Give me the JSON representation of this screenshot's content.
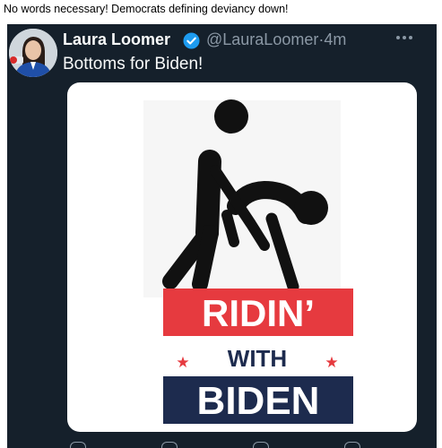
{
  "post": {
    "caption": "No words necessary! Democrats defining deviancy down!"
  },
  "tweet": {
    "author_name": "Laura Loomer",
    "handle": "@LauraLoomer",
    "separator": "·",
    "time": "4m",
    "text": "Bottoms for Biden!",
    "verified_icon": "verified-badge-icon",
    "more_icon": "more-options-icon"
  },
  "image": {
    "line1": "RIDIN’",
    "line2": "WITH",
    "line3": "BIDEN",
    "star_left": "★",
    "star_right": "★"
  },
  "colors": {
    "tweet_background": "#15202b",
    "red_banner": "#e63a3f",
    "navy_banner": "#1d2b4e",
    "verified_blue": "#1d9bf0"
  }
}
